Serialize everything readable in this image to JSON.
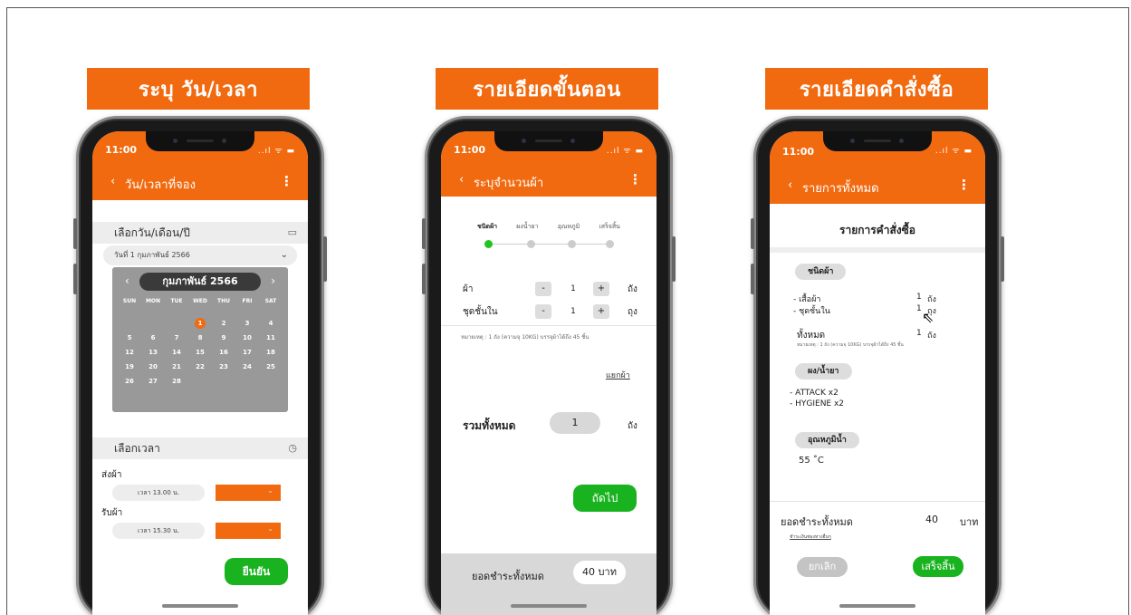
{
  "banners": [
    "ระบุ วัน/เวลา",
    "รายเอียดขั้นตอน",
    "รายเอียดคำสั่งซื้อ"
  ],
  "status": {
    "time": "11:00",
    "icons": "..ıl ᯤ ▬"
  },
  "icons": {
    "back": "chevron-left-icon",
    "kebab": "kebab-menu-icon",
    "calendar": "calendar-icon",
    "clock": "clock-icon",
    "cursor": "mouse-pointer-icon"
  },
  "colors": {
    "accent": "#f26a10",
    "confirm": "#19b31f"
  },
  "phone1": {
    "header_title": "วัน/เวลาที่จอง",
    "date_section": "เลือกวัน/เดือน/ปี",
    "date_value": "วันที่ 1 กุมภาพันธ์ 2566",
    "calendar": {
      "month": "กุมภาพันธ์ 2566",
      "weekdays": [
        "SUN",
        "MON",
        "TUE",
        "WED",
        "THU",
        "FRI",
        "SAT"
      ],
      "days": [
        "",
        "",
        "",
        "1",
        "2",
        "3",
        "4",
        "5",
        "6",
        "7",
        "8",
        "9",
        "10",
        "11",
        "12",
        "13",
        "14",
        "15",
        "16",
        "17",
        "18",
        "19",
        "20",
        "21",
        "22",
        "23",
        "24",
        "25",
        "26",
        "27",
        "28"
      ],
      "selected": "1"
    },
    "time_section": "เลือกเวลา",
    "send_label": "ส่งผ้า",
    "send_time": "เวลา 13.00 น.",
    "pickup_label": "รับผ้า",
    "pickup_time": "เวลา 15.30 น.",
    "confirm": "ยืนยัน"
  },
  "phone2": {
    "header_title": "ระบุจำนวนผ้า",
    "steps": [
      "ชนิดผ้า",
      "ผงน้ำยา",
      "อุณหภูมิ",
      "เสร็จสิ้น"
    ],
    "active_step": 0,
    "items": [
      {
        "label": "ผ้า",
        "minus": "-",
        "qty": "1",
        "plus": "+",
        "unit": "ถัง"
      },
      {
        "label": "ชุดชั้นใน",
        "minus": "-",
        "qty": "1",
        "plus": "+",
        "unit": "ถุง"
      }
    ],
    "note": "หมายเหตุ : 1 ถัง (ความจุ 10KG) บรรจุผ้าได้ถึง 45 ชิ้น",
    "separate_link": "แยกผ้า",
    "total_label": "รวมทั้งหมด",
    "total_value": "1",
    "total_unit": "ถัง",
    "next": "ถัดไป",
    "grand_label": "ยอดชำระทั้งหมด",
    "grand_value": "40 บาท"
  },
  "phone3": {
    "header_title": "รายการทั้งหมด",
    "order_title": "รายการคำสั่งซื้อ",
    "fabric_chip": "ชนิดผ้า",
    "fabric_items": [
      {
        "name": "- เสื้อผ้า",
        "qty": "1",
        "unit": "ถัง"
      },
      {
        "name": "- ชุดชั้นใน",
        "qty": "1",
        "unit": "ถุง"
      }
    ],
    "fabric_total_label": "ทั้งหมด",
    "fabric_total_qty": "1",
    "fabric_total_unit": "ถัง",
    "fabric_note": "หมายเหตุ : 1 ถัง (ความจุ 10KG) บรรจุผ้าได้ถึง 45 ชิ้น",
    "powder_chip": "ผง/น้ำยา",
    "powder_items": [
      "- ATTACK x2",
      "- HYGIENE x2"
    ],
    "temp_chip": "อุณหภูมิน้ำ",
    "temp_value": "55 ˚C",
    "pay_label": "ยอดชำระทั้งหมด",
    "pay_amount": "40",
    "pay_unit": "บาท",
    "pay_link": "ชำระเงินช่องทางอื่นๆ",
    "cancel": "ยกเลิก",
    "done": "เสร็จสิ้น"
  }
}
